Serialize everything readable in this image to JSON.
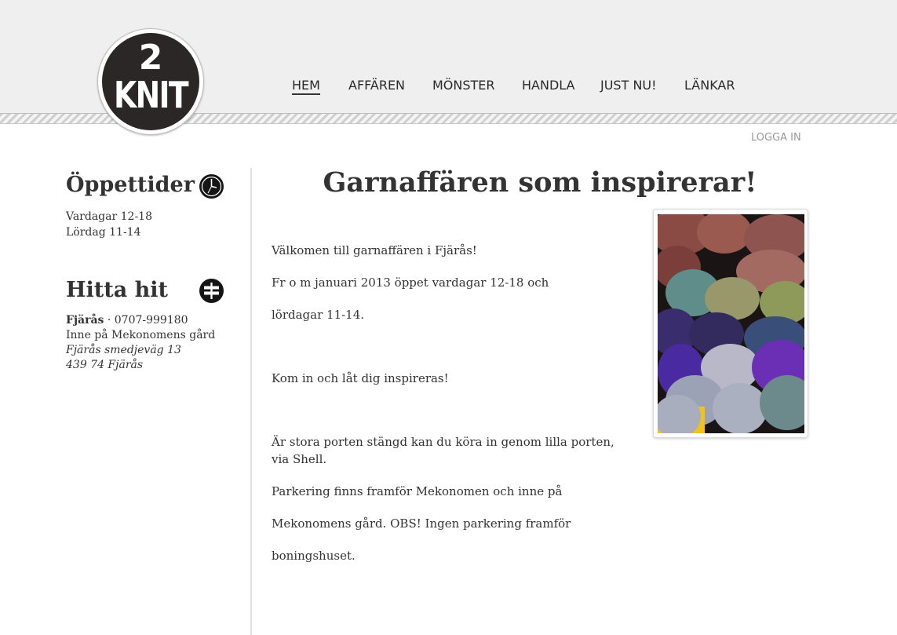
{
  "logo": {
    "top": "2",
    "bottom": "KNIT"
  },
  "nav": {
    "items": [
      {
        "label": "HEM",
        "active": true
      },
      {
        "label": "AFFÄREN",
        "active": false
      },
      {
        "label": "MÖNSTER",
        "active": false
      },
      {
        "label": "HANDLA",
        "active": false
      },
      {
        "label": "JUST NU!",
        "active": false
      },
      {
        "label": "LÄNKAR",
        "active": false
      }
    ],
    "login": "LOGGA IN"
  },
  "sidebar": {
    "hours": {
      "heading": "Öppettider",
      "icon": "clock-icon",
      "lines": [
        "Vardagar 12-18",
        "Lördag 11-14"
      ]
    },
    "directions": {
      "heading": "Hitta hit",
      "icon": "signpost-icon",
      "town": "Fjärås",
      "phone": " · 0707-999180",
      "line2": "Inne på Mekonomens gård",
      "street": "Fjärås smedjeväg 13",
      "postal": "439 74 Fjärås"
    }
  },
  "main": {
    "title": "Garnaffären som inspirerar!",
    "paragraphs": [
      "Välkomen till garnaffären i Fjärås!",
      "Fr o m januari 2013 öppet vardagar 12-18 och",
      "lördagar 11-14.",
      "Kom in och låt dig inspireras!",
      "Är stora porten stängd kan du köra in genom lilla porten, via Shell.",
      "Parkering finns framför Mekonomen och inne på",
      "Mekonomens gård. OBS! Ingen parkering framför",
      "boningshuset."
    ],
    "photo_icon": "yarn-photo"
  },
  "colors": {
    "logo_bg": "#2b2726",
    "header_bg": "#efefef",
    "divider": "#e0e0e0",
    "login": "#999999"
  }
}
